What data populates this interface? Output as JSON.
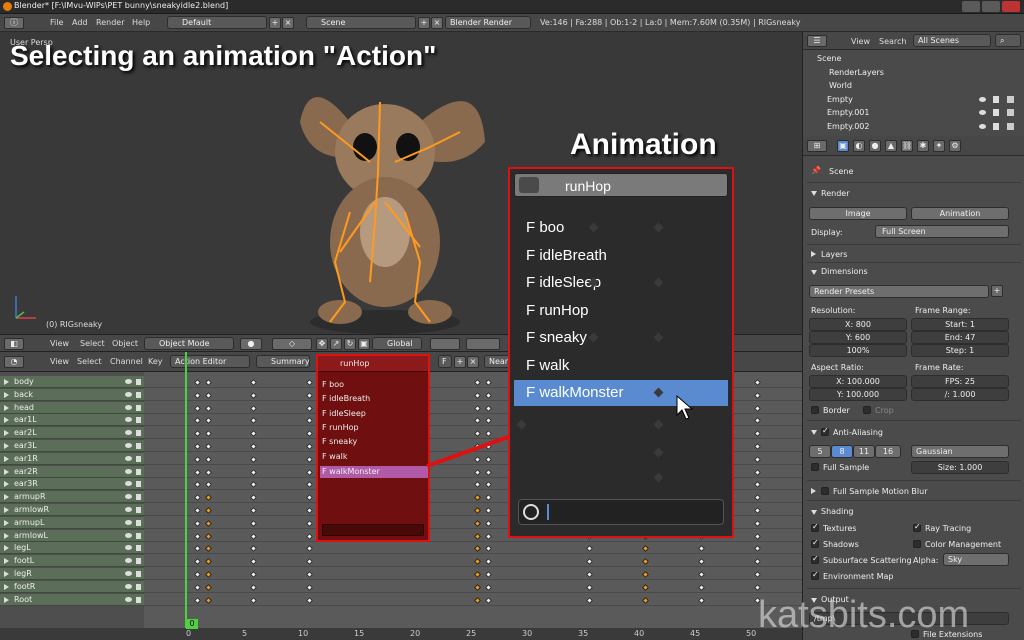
{
  "window": {
    "title": "Blender* [F:\\IMvu-WIPs\\PET bunny\\sneakyidle2.blend]"
  },
  "menu": {
    "file": "File",
    "add": "Add",
    "render": "Render",
    "help": "Help",
    "screen": "Default",
    "scene": "Scene",
    "engine": "Blender Render",
    "stats": "Ve:146 | Fa:288 | Ob:1-2 | La:0 | Mem:7.60M (0.35M) | RIGsneaky"
  },
  "viewport": {
    "overlay": "Selecting an animation \"Action\"",
    "persp": "User Persp",
    "object": "(0) RIGsneaky"
  },
  "vpheader": {
    "view": "View",
    "select": "Select",
    "object": "Object",
    "mode": "Object Mode",
    "orient": "Global"
  },
  "dsheader": {
    "view": "View",
    "select": "Select",
    "channel": "Channel",
    "key": "Key",
    "mode": "Action Editor",
    "summary": "Summary",
    "action": "runHop",
    "fake": "F",
    "near": "Near"
  },
  "channels": [
    "body",
    "back",
    "head",
    "ear1L",
    "ear2L",
    "ear3L",
    "ear1R",
    "ear2R",
    "ear3R",
    "armupR",
    "armlowR",
    "armupL",
    "armlowL",
    "legL",
    "footL",
    "legR",
    "footR",
    "Root"
  ],
  "timeline": {
    "ticks": [
      "0",
      "5",
      "10",
      "15",
      "20",
      "25",
      "30",
      "35",
      "40",
      "45",
      "50"
    ],
    "current": "0"
  },
  "small_dropdown": {
    "header": "runHop",
    "options": [
      "F boo",
      "F idleBreath",
      "F idleSleep",
      "F runHop",
      "F sneaky",
      "F walk",
      "F walkMonster"
    ],
    "selected": "F walkMonster"
  },
  "big_dropdown": {
    "title": "Animation",
    "header": "runHop",
    "options": [
      "F boo",
      "F idleBreath",
      "F idleSleep",
      "F runHop",
      "F sneaky",
      "F walk"
    ],
    "selected": "F walkMonster"
  },
  "outliner": {
    "view": "View",
    "search": "Search",
    "filter": "All Scenes",
    "items": [
      "Scene",
      "RenderLayers",
      "World",
      "Empty",
      "Empty.001",
      "Empty.002"
    ]
  },
  "properties": {
    "scene": "Scene",
    "render": "Render",
    "image_btn": "Image",
    "anim_btn": "Animation",
    "display_label": "Display:",
    "display_value": "Full Screen",
    "layers": "Layers",
    "dimensions": "Dimensions",
    "presets": "Render Presets",
    "resolution": "Resolution:",
    "res_x": "X: 800",
    "res_y": "Y: 600",
    "res_pct": "100%",
    "frame_range": "Frame Range:",
    "start": "Start: 1",
    "end": "End: 47",
    "step": "Step: 1",
    "aspect": "Aspect Ratio:",
    "asp_x": "X: 100.000",
    "asp_y": "Y: 100.000",
    "frame_rate": "Frame Rate:",
    "fps": "FPS: 25",
    "fbase": "/: 1.000",
    "border": "Border",
    "crop": "Crop",
    "aa": "Anti-Aliasing",
    "aa_levels": [
      "5",
      "8",
      "11",
      "16"
    ],
    "aa_filter": "Gaussian",
    "full_sample": "Full Sample",
    "size": "Size: 1.000",
    "fsmb": "Full Sample Motion Blur",
    "shading": "Shading",
    "textures": "Textures",
    "ray": "Ray Tracing",
    "shadows": "Shadows",
    "color_mgmt": "Color Management",
    "sss": "Subsurface Scattering",
    "alpha": "Alpha:",
    "alpha_value": "Sky",
    "envmap": "Environment Map",
    "output": "Output",
    "tmp": "/tmp\\",
    "file_ext": "File Extensions"
  },
  "watermark": "katsbits.com",
  "colors": {
    "selection": "#5a8bd0",
    "highlight_red": "#e01010",
    "frame": "#4fd03f"
  }
}
